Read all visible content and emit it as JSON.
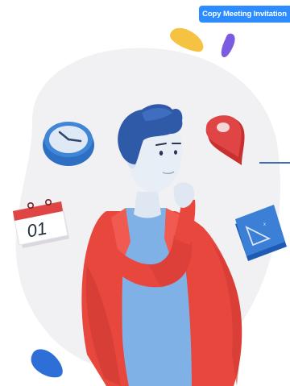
{
  "toolbar": {
    "copy_invitation_label": "Copy Meeting Invitation"
  },
  "calendar": {
    "day_text": "01"
  },
  "colors": {
    "accent": "#2d8cff",
    "jacket": "#e8473e",
    "hair": "#2f5aa8",
    "shirt": "#7fb1e6",
    "blob": "#f1f1f4",
    "pin": "#e04545",
    "yellow": "#f5c242",
    "purple": "#7b5be0"
  }
}
